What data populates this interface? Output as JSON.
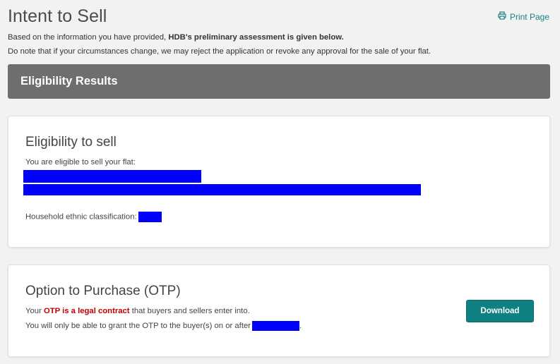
{
  "header": {
    "title": "Intent to Sell",
    "print_label": "Print Page",
    "intro_1a": "Based on the information you have provided, ",
    "intro_1b": "HDB's preliminary assessment is given below.",
    "intro_2": "Do note that if your circumstances change, we may reject the application or revoke any approval for the sale of your flat."
  },
  "results_bar": {
    "label": "Eligibility Results"
  },
  "eligibility": {
    "title": "Eligibility to sell",
    "eligible_text": "You are eligible to sell your flat:",
    "ethnic_label": "Household ethnic classification:"
  },
  "otp": {
    "title": "Option to Purchase (OTP)",
    "line1_a": "Your ",
    "line1_red": "OTP is a legal contract",
    "line1_b": " that buyers and sellers enter into.",
    "line2": "You will only be able to grant the OTP to the buyer(s) on or after",
    "line2_end": ".",
    "download_label": "Download"
  },
  "colors": {
    "accent": "#0f8181",
    "results_bar": "#6e6e6e",
    "redaction": "#0000ff",
    "legal_red": "#c00000"
  },
  "icons": {
    "print": "printer-icon"
  }
}
